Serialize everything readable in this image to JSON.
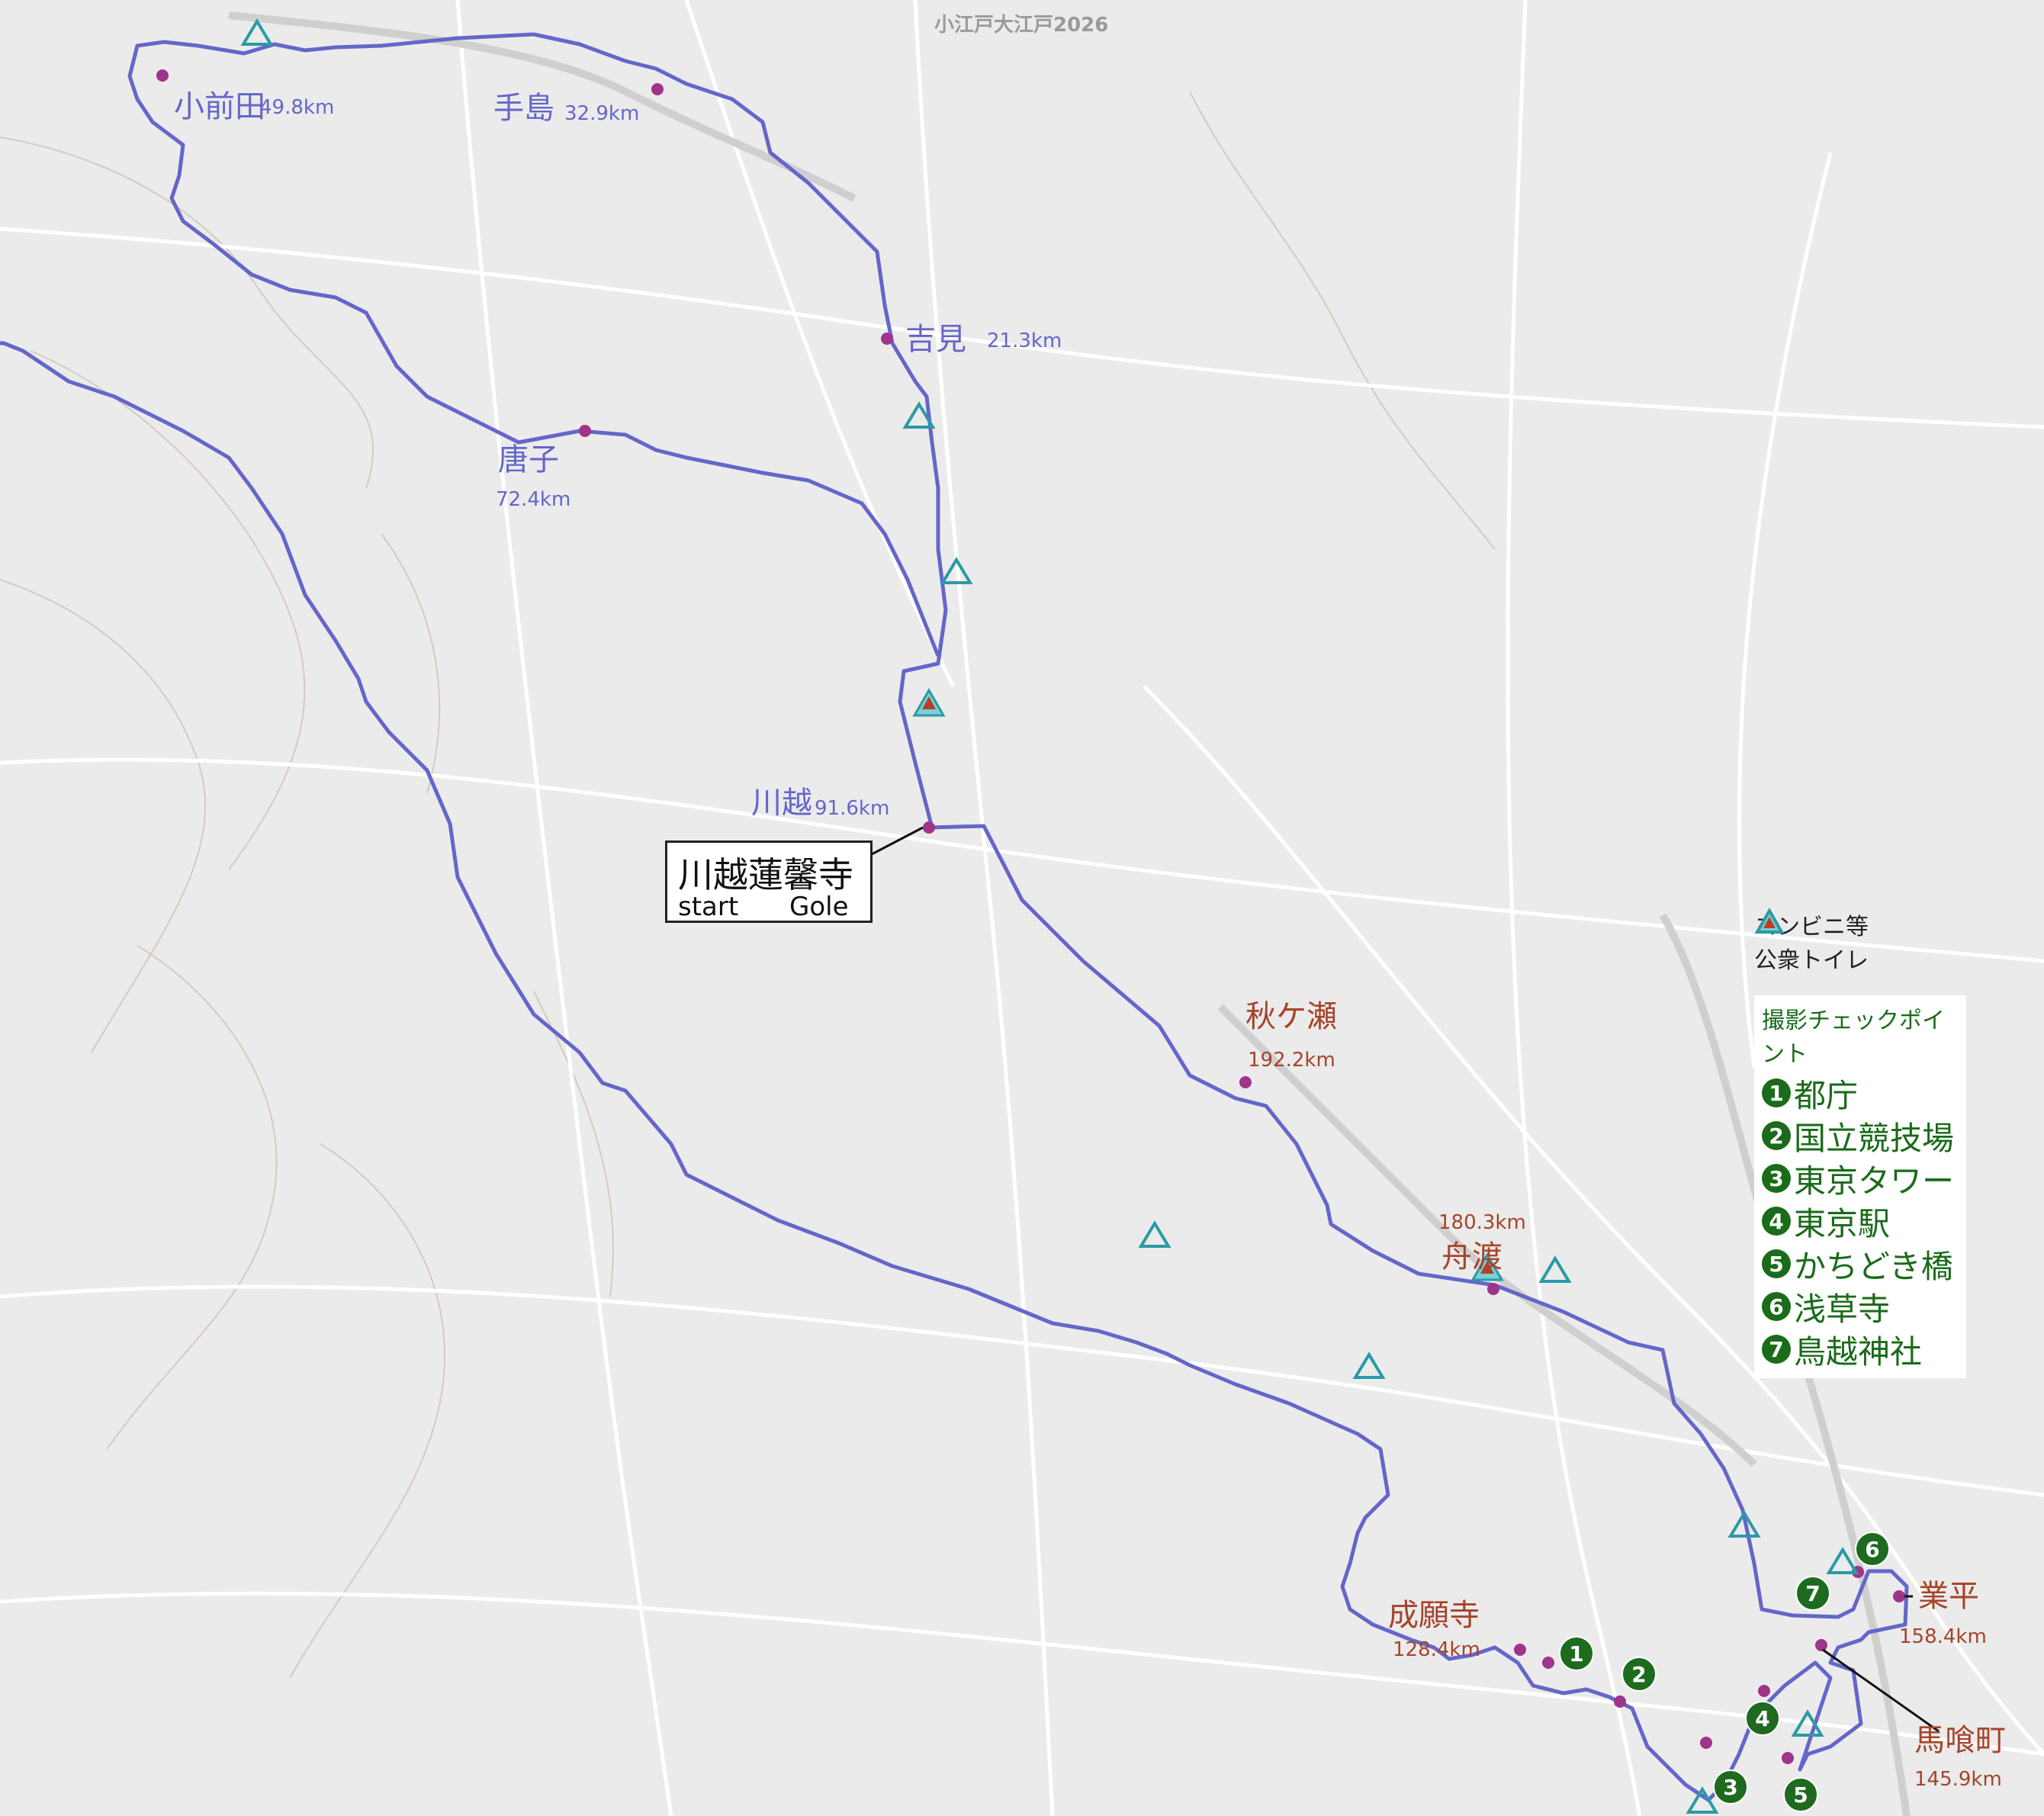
{
  "map_title": "小江戸大江戸2026",
  "route_color": "#6466c9",
  "waypoint_color": "#a0338a",
  "start": {
    "name": "川越蓮馨寺",
    "start_label": "start",
    "goal_label": "Gole"
  },
  "places": [
    {
      "name": "小前田",
      "km": "49.8km"
    },
    {
      "name": "手島",
      "km": "32.9km"
    },
    {
      "name": "吉見",
      "km": "21.3km"
    },
    {
      "name": "唐子",
      "km": "72.4km"
    },
    {
      "name": "川越",
      "km": "91.6km"
    },
    {
      "name": "秋ケ瀬",
      "km": "192.2km"
    },
    {
      "name": "舟渡",
      "km": "180.3km"
    },
    {
      "name": "成願寺",
      "km": "128.4km"
    },
    {
      "name": "業平",
      "km": "158.4km"
    },
    {
      "name": "馬喰町",
      "km": "145.9km"
    }
  ],
  "legend": {
    "convenience": "コンビニ等",
    "toilet": "公衆トイレ"
  },
  "checkpoints": {
    "title": "撮影チェックポイント",
    "items": [
      {
        "num": "1",
        "name": "都庁"
      },
      {
        "num": "2",
        "name": "国立競技場"
      },
      {
        "num": "3",
        "name": "東京タワー"
      },
      {
        "num": "4",
        "name": "東京駅"
      },
      {
        "num": "5",
        "name": "かちどき橋"
      },
      {
        "num": "6",
        "name": "浅草寺"
      },
      {
        "num": "7",
        "name": "鳥越神社"
      }
    ]
  }
}
